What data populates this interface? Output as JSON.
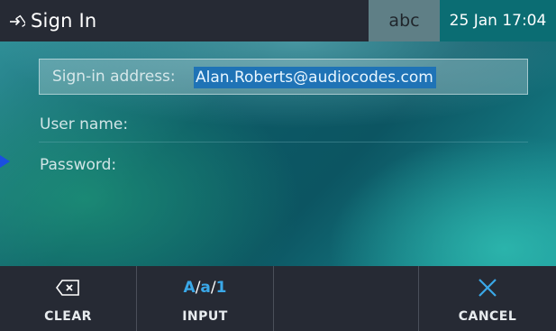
{
  "header": {
    "title": "Sign In",
    "title_icon": "sign-in-icon",
    "input_mode": "abc",
    "datetime": "25 Jan 17:04"
  },
  "form": {
    "signin_label": "Sign-in address:",
    "signin_value": "Alan.Roberts@audiocodes.com",
    "username_label": "User name:",
    "password_label": "Password:"
  },
  "softkeys": [
    {
      "label": "CLEAR",
      "icon": "backspace-icon"
    },
    {
      "label": "INPUT",
      "icon": "input-mode-icon",
      "glyph_a": "A",
      "glyph_b": "a",
      "glyph_c": "1",
      "sep": "/"
    },
    {
      "label": "",
      "icon": ""
    },
    {
      "label": "CANCEL",
      "icon": "close-icon"
    }
  ],
  "colors": {
    "topbar_bg": "#262a34",
    "input_mode_bg": "#5f7f86",
    "datetime_bg": "#0b6d73",
    "selection_bg": "#1f73b6",
    "accent_blue": "#3aa8e8",
    "focus_arrow": "#1a4fe0"
  }
}
